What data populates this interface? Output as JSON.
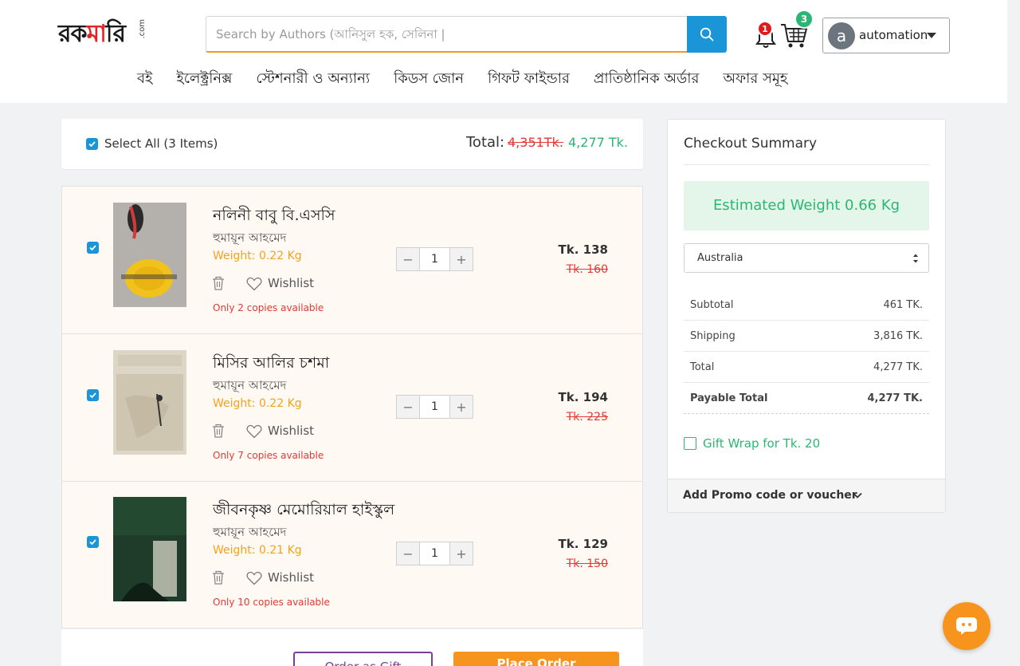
{
  "header": {
    "search_placeholder": "Search by Authors (আনিসুল হক, সেলিনা |",
    "notification_count": "1",
    "cart_count": "3",
    "user": {
      "initial": "a",
      "name": "automation"
    }
  },
  "nav": {
    "items": [
      "বই",
      "ইলেক্ট্রনিক্স",
      "স্টেশনারী ও অন্যান্য",
      "কিডস জোন",
      "গিফট ফাইন্ডার",
      "প্রাতিষ্ঠানিক অর্ডার",
      "অফার সমূহ"
    ]
  },
  "cart": {
    "select_all_label": "Select All (3 Items)",
    "total_label": "Total:",
    "total_old": "4,351Tk.",
    "total_new": "4,277 Tk.",
    "wishlist_label": "Wishlist",
    "items": [
      {
        "title": "নলিনী বাবু বি.এসসি",
        "author": "হুমায়ূন আহমেদ",
        "weight": "Weight:  0.22  Kg",
        "stock": "Only  2  copies  available",
        "qty": "1",
        "price": "Tk. 138",
        "old_price": "Tk. 160",
        "checked": true
      },
      {
        "title": "মিসির আলির চশমা",
        "author": "হুমায়ূন আহমেদ",
        "weight": "Weight:  0.22  Kg",
        "stock": "Only  7  copies  available",
        "qty": "1",
        "price": "Tk. 194",
        "old_price": "Tk. 225",
        "checked": true
      },
      {
        "title": "জীবনকৃষ্ণ মেমোরিয়াল হাইস্কুল",
        "author": "হুমায়ূন আহমেদ",
        "weight": "Weight:  0.21  Kg",
        "stock": "Only  10  copies  available",
        "qty": "1",
        "price": "Tk. 129",
        "old_price": "Tk. 150",
        "checked": true
      }
    ],
    "secondary_button": "Order as Gift",
    "place_order_button": "Place Order"
  },
  "summary": {
    "title": "Checkout Summary",
    "estimated_weight": "Estimated Weight 0.66 Kg",
    "country": "Australia",
    "rows": [
      {
        "label": "Subtotal",
        "value": "461 TK."
      },
      {
        "label": "Shipping",
        "value": "3,816 TK."
      },
      {
        "label": "Total",
        "value": "4,277 TK."
      },
      {
        "label": "Payable Total",
        "value": "4,277 TK."
      }
    ],
    "gift_wrap_label": "Gift Wrap for Tk. 20",
    "promo_label": "Add Promo code or voucher"
  },
  "colors": {
    "brand_blue": "#1a96d8",
    "price_red": "#e53935",
    "success_green": "#2bb673",
    "weight_orange": "#f3a21b",
    "order_orange": "#f7941d"
  }
}
